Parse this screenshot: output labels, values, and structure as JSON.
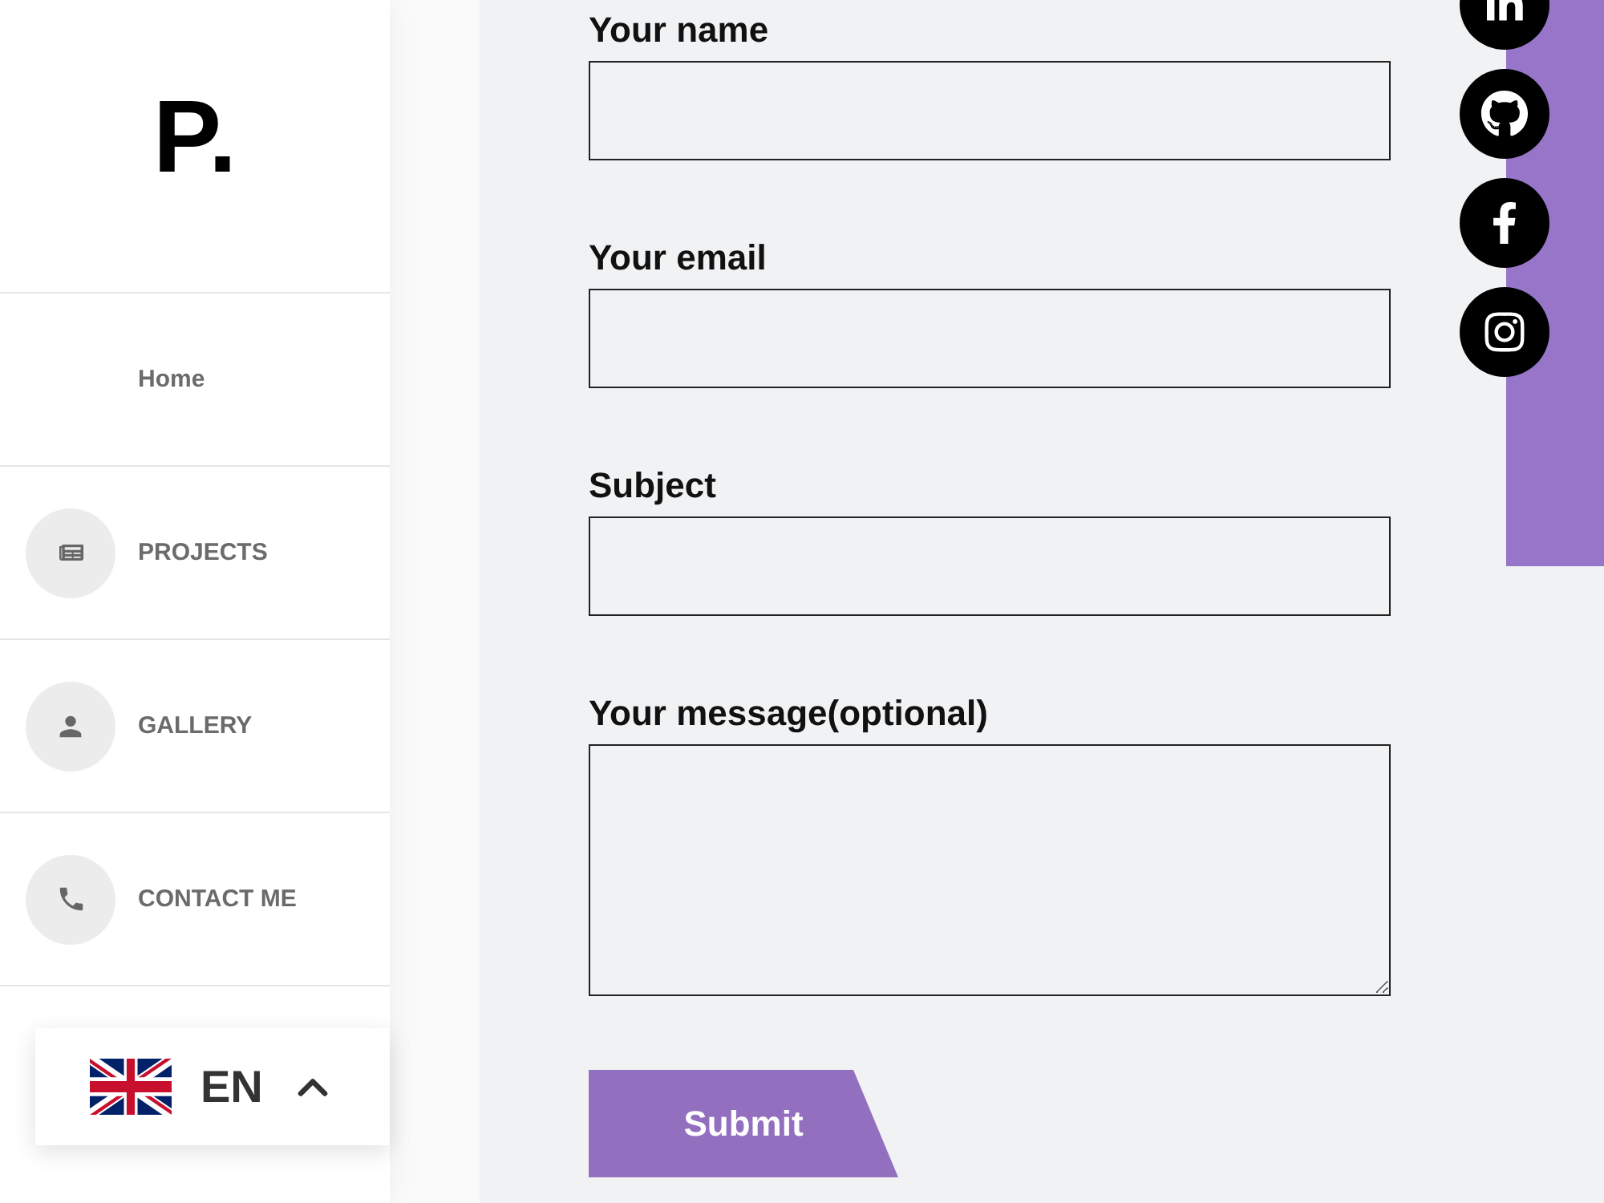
{
  "sidebar": {
    "logo": "P.",
    "nav": [
      {
        "label": "Home",
        "kind": "plain"
      },
      {
        "label": "PROJECTS",
        "kind": "newspaper"
      },
      {
        "label": "GALLERY",
        "kind": "person"
      },
      {
        "label": "CONTACT ME",
        "kind": "phone"
      }
    ],
    "language": {
      "code": "EN"
    }
  },
  "form": {
    "fields": [
      {
        "label": "Your name",
        "kind": "input"
      },
      {
        "label": "Your email",
        "kind": "input"
      },
      {
        "label": "Subject",
        "kind": "input"
      },
      {
        "label": "Your message(optional)",
        "kind": "textarea"
      }
    ],
    "submit": "Submit"
  }
}
